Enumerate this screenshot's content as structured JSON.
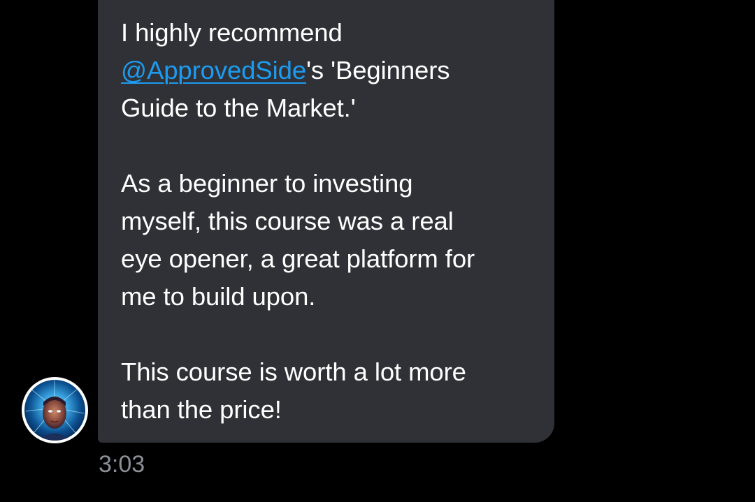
{
  "message": {
    "line1": "I highly recommend",
    "mention": "@ApprovedSide",
    "line2_rest": "'s 'Beginners",
    "line3": "Guide to the Market.'",
    "para2_line1": "As a beginner to investing",
    "para2_line2": "myself, this course was a real",
    "para2_line3": "eye opener, a great platform for",
    "para2_line4": "me to build upon.",
    "para3_line1": "This course is worth a lot more",
    "para3_line2": "than the price!",
    "timestamp": "3:03"
  },
  "colors": {
    "background": "#000000",
    "bubble": "#2f3136",
    "text": "#ffffff",
    "mention": "#1d9bf0",
    "timestamp": "#8b8f96"
  },
  "icons": {
    "avatar": "user-avatar-icon"
  }
}
